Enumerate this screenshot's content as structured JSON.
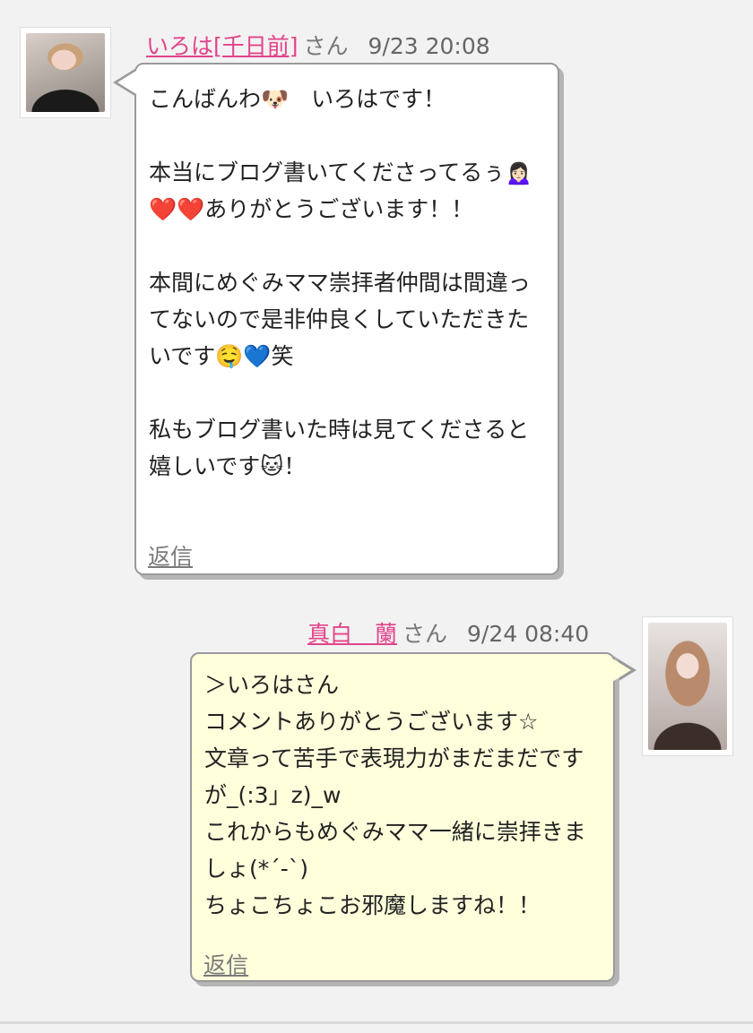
{
  "comments": [
    {
      "name": "いろは[千日前]",
      "honorific": "さん",
      "datetime": "9/23 20:08",
      "body": "こんばんわ🐶　いろはです！\n\n本当にブログ書いてくださってるぅ🙍🏻‍♀️❤️❤️ありがとうございます！！\n\n本間にめぐみママ崇拝者仲間は間違ってないので是非仲良くしていただきたいです🤤💙笑\n\n私もブログ書いた時は見てくださると嬉しいです🐱！",
      "reply_label": "返信"
    },
    {
      "name": "真白　蘭",
      "honorific": "さん",
      "datetime": "9/24 08:40",
      "body": "＞いろはさん\nコメントありがとうございます☆\n文章って苦手で表現力がまだまだですが_(:3」z)_w\nこれからもめぐみママ一緒に崇拝きましょ(*´-`)\nちょこちょこお邪魔しますね！！",
      "reply_label": "返信"
    }
  ]
}
